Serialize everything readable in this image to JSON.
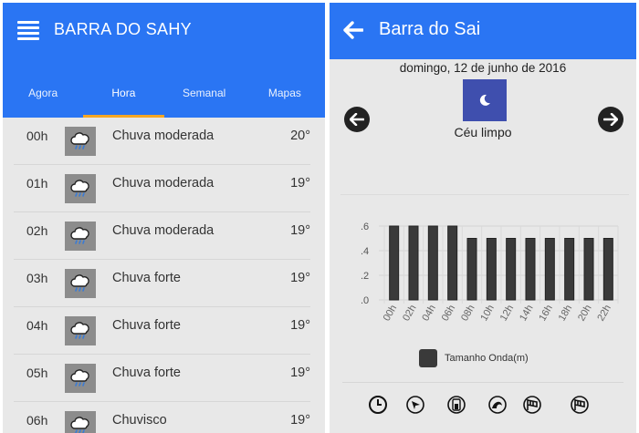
{
  "left": {
    "title": "BARRA DO SAHY",
    "tabs": [
      {
        "label": "Agora"
      },
      {
        "label": "Hora"
      },
      {
        "label": "Semanal"
      },
      {
        "label": "Mapas"
      }
    ],
    "active_tab": "Hora",
    "hours": [
      {
        "hour": "00h",
        "desc": "Chuva moderada",
        "temp": "20°",
        "icon": "rain-cloud-icon"
      },
      {
        "hour": "01h",
        "desc": "Chuva moderada",
        "temp": "19°",
        "icon": "rain-cloud-icon"
      },
      {
        "hour": "02h",
        "desc": "Chuva moderada",
        "temp": "19°",
        "icon": "rain-cloud-icon"
      },
      {
        "hour": "03h",
        "desc": "Chuva forte",
        "temp": "19°",
        "icon": "rain-cloud-icon"
      },
      {
        "hour": "04h",
        "desc": "Chuva forte",
        "temp": "19°",
        "icon": "rain-cloud-icon"
      },
      {
        "hour": "05h",
        "desc": "Chuva forte",
        "temp": "19°",
        "icon": "rain-cloud-icon"
      },
      {
        "hour": "06h",
        "desc": "Chuvisco",
        "temp": "19°",
        "icon": "rain-cloud-icon"
      }
    ]
  },
  "right": {
    "title": "Barra do Sai",
    "date": "domingo, 12 de junho de 2016",
    "condition": "Céu limpo",
    "condition_icon": "moon-icon",
    "bottom_icons": [
      "clock-icon",
      "wind-direction-icon",
      "tide-icon",
      "wave-icon",
      "wind-flag-icon",
      "wind-flag-icon"
    ]
  },
  "colors": {
    "header_blue": "#2a75f3",
    "tab_indicator": "#f5a623",
    "bar": "#3a3a3a",
    "moon_bg": "#3f4fae"
  },
  "chart_data": {
    "type": "bar",
    "categories": [
      "00h",
      "02h",
      "04h",
      "06h",
      "08h",
      "10h",
      "12h",
      "14h",
      "16h",
      "18h",
      "20h",
      "22h"
    ],
    "series": [
      {
        "name": "Tamanho Onda(m)",
        "values": [
          0.6,
          0.6,
          0.6,
          0.6,
          0.5,
          0.5,
          0.5,
          0.5,
          0.5,
          0.5,
          0.5,
          0.5
        ]
      }
    ],
    "yticks": [
      ".6",
      ".4",
      ".2",
      ".0"
    ],
    "ylim": [
      0,
      0.6
    ],
    "xlabel": "",
    "ylabel": "",
    "grid": true,
    "legend_position": "bottom"
  }
}
